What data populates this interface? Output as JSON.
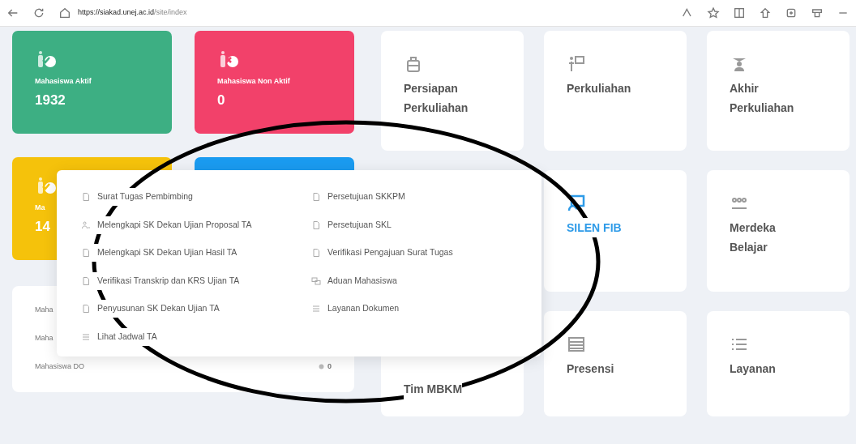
{
  "browser": {
    "url_host": "https://siakad.unej.ac.id",
    "url_path": "/site/index"
  },
  "stat_cards": [
    {
      "label": "Mahasiswa Aktif",
      "value": "1932",
      "color": "#3daf83",
      "kind": "check"
    },
    {
      "label": "Mahasiswa Non Aktif",
      "value": "0",
      "color": "#f2416a",
      "kind": "cross"
    },
    {
      "label": "Ma",
      "value": "14",
      "color": "#f5c20b",
      "kind": "check"
    },
    {
      "color": "#1a9bf0",
      "kind": "none"
    }
  ],
  "stat_list": [
    {
      "label": "Maha"
    },
    {
      "label": "Maha"
    },
    {
      "label": "Mahasiswa DO",
      "value": "0"
    }
  ],
  "tiles": [
    {
      "title": "Persiapan Perkuliahan",
      "kind": "bag",
      "active": false
    },
    {
      "title": "Perkuliahan",
      "kind": "teacher",
      "active": false
    },
    {
      "title": "Akhir Perkuliahan",
      "kind": "graduate",
      "active": false
    },
    {
      "title": "SILEN FIB",
      "kind": "monitor",
      "active": true
    },
    {
      "title": "Merdeka Belajar",
      "kind": "people",
      "active": false
    },
    {
      "title": "Tim MBKM",
      "kind": "none",
      "active": false
    },
    {
      "title": "Presensi",
      "kind": "table",
      "active": false
    },
    {
      "title": "Layanan",
      "kind": "list",
      "active": false
    }
  ],
  "dropdown_menu": {
    "columns": [
      [
        {
          "label": "Surat Tugas Pembimbing",
          "kind": "doc"
        },
        {
          "label": "Melengkapi SK Dekan Ujian Proposal TA",
          "kind": "user"
        },
        {
          "label": "Melengkapi SK Dekan Ujian Hasil TA",
          "kind": "doc"
        },
        {
          "label": "Verifikasi Transkrip dan KRS Ujian TA",
          "kind": "doc"
        },
        {
          "label": "Penyusunan SK Dekan Ujian TA",
          "kind": "doc"
        },
        {
          "label": "Lihat Jadwal TA",
          "kind": "list"
        }
      ],
      [
        {
          "label": "Persetujuan SKKPM",
          "kind": "doc"
        },
        {
          "label": "Persetujuan SKL",
          "kind": "doc"
        },
        {
          "label": "Verifikasi Pengajuan Surat Tugas",
          "kind": "doc"
        },
        {
          "label": "Aduan Mahasiswa",
          "kind": "chat"
        },
        {
          "label": "Layanan Dokumen",
          "kind": "list"
        }
      ]
    ]
  }
}
